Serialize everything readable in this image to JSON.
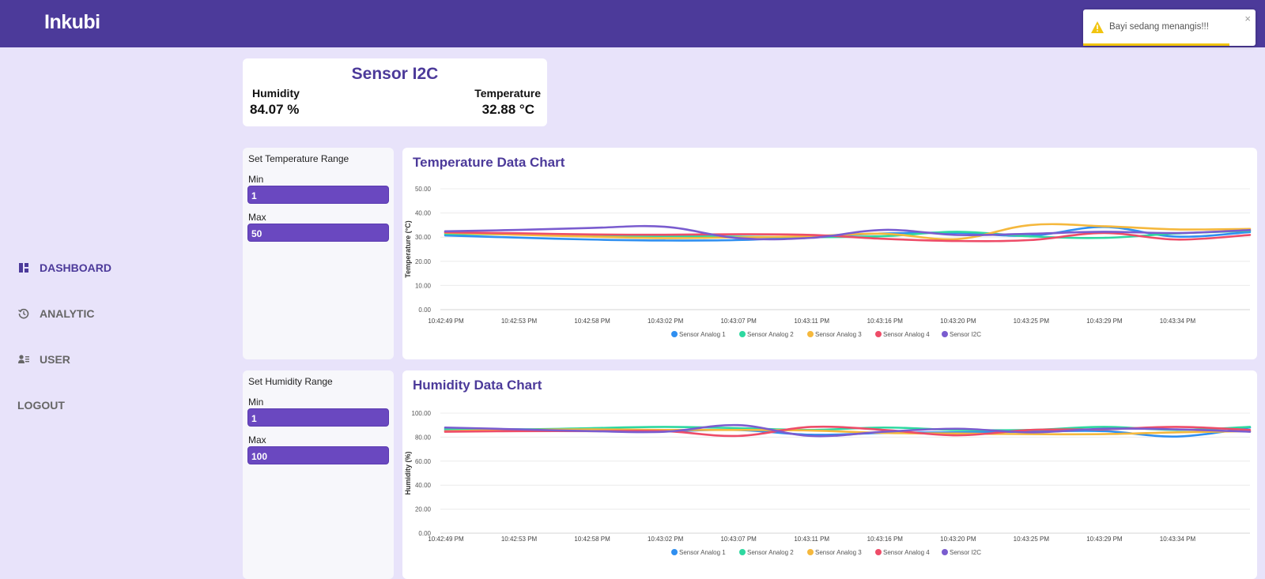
{
  "app": {
    "brand": "Inkubi"
  },
  "toast": {
    "message": "Bayi sedang menangis!!!",
    "close": "×",
    "icon": "warning-icon",
    "progress": 0.85
  },
  "nav": {
    "items": [
      {
        "label": "DASHBOARD",
        "icon": "dashboard-icon",
        "active": true
      },
      {
        "label": "ANALYTIC",
        "icon": "history-icon",
        "active": false
      },
      {
        "label": "USER",
        "icon": "user-list-icon",
        "active": false
      },
      {
        "label": "LOGOUT",
        "icon": "",
        "active": false
      }
    ]
  },
  "sensor_i2c": {
    "title": "Sensor I2C",
    "humidity_label": "Humidity",
    "humidity_value": "84.07 %",
    "temperature_label": "Temperature",
    "temperature_value": "32.88 °C"
  },
  "temp_range": {
    "title": "Set Temperature Range",
    "min_label": "Min",
    "min_value": "1",
    "max_label": "Max",
    "max_value": "50"
  },
  "hum_range": {
    "title": "Set Humidity Range",
    "min_label": "Min",
    "min_value": "1",
    "max_label": "Max",
    "max_value": "100"
  },
  "colors": {
    "accent": "#4c3a9a",
    "series": [
      "#2f8ff0",
      "#2ed8a0",
      "#f5b83d",
      "#ee4c68",
      "#7a5ccf"
    ]
  },
  "chart_data": [
    {
      "type": "line",
      "title": "Temperature Data Chart",
      "ylabel": "Temperature (°C)",
      "ylim": [
        0,
        50
      ],
      "yticks": [
        "0.00",
        "10.00",
        "20.00",
        "30.00",
        "40.00",
        "50.00"
      ],
      "x": [
        "10:42:49 PM",
        "10:42:53 PM",
        "10:42:58 PM",
        "10:43:02 PM",
        "10:43:07 PM",
        "10:43:11 PM",
        "10:43:16 PM",
        "10:43:20 PM",
        "10:43:25 PM",
        "10:43:29 PM",
        "10:43:34 PM",
        ""
      ],
      "grid": true,
      "legend": "bottom",
      "series": [
        {
          "name": "Sensor Analog 1",
          "values": [
            30.7,
            29.8,
            29.0,
            28.6,
            28.8,
            30.1,
            31.5,
            31.8,
            30.6,
            34.2,
            30.2,
            32.1
          ]
        },
        {
          "name": "Sensor Analog 2",
          "values": [
            31.3,
            31.1,
            30.6,
            30.5,
            30.2,
            30.0,
            30.4,
            32.2,
            30.3,
            29.7,
            31.5,
            32.6
          ]
        },
        {
          "name": "Sensor Analog 3",
          "values": [
            31.8,
            31.0,
            30.2,
            29.6,
            29.9,
            30.4,
            31.4,
            29.2,
            35.0,
            34.5,
            33.2,
            33.4
          ]
        },
        {
          "name": "Sensor Analog 4",
          "values": [
            32.0,
            31.6,
            31.1,
            31.0,
            31.2,
            30.9,
            29.3,
            28.4,
            28.8,
            31.7,
            29.0,
            30.9
          ]
        },
        {
          "name": "Sensor I2C",
          "values": [
            32.4,
            33.0,
            33.8,
            34.3,
            29.6,
            29.7,
            33.0,
            30.9,
            31.4,
            32.2,
            31.7,
            32.9
          ]
        }
      ]
    },
    {
      "type": "line",
      "title": "Humidity Data Chart",
      "ylabel": "Humidity (%)",
      "ylim": [
        0,
        100
      ],
      "yticks": [
        "0.00",
        "20.00",
        "40.00",
        "60.00",
        "80.00",
        "100.00"
      ],
      "x": [
        "10:42:49 PM",
        "10:42:53 PM",
        "10:42:58 PM",
        "10:43:02 PM",
        "10:43:07 PM",
        "10:43:11 PM",
        "10:43:16 PM",
        "10:43:20 PM",
        "10:43:25 PM",
        "10:43:29 PM",
        "10:43:34 PM",
        ""
      ],
      "grid": true,
      "legend": "bottom",
      "series": [
        {
          "name": "Sensor Analog 1",
          "values": [
            86,
            86.5,
            85.5,
            85,
            86,
            82,
            83.5,
            84,
            84.5,
            85,
            80.5,
            88
          ]
        },
        {
          "name": "Sensor Analog 2",
          "values": [
            87,
            86.5,
            87.5,
            88.5,
            87.5,
            86,
            88,
            86,
            86,
            88.5,
            86,
            88.5
          ]
        },
        {
          "name": "Sensor Analog 3",
          "values": [
            85,
            86,
            86.5,
            86,
            86,
            85.5,
            83.5,
            83,
            82.5,
            82.5,
            84,
            85
          ]
        },
        {
          "name": "Sensor Analog 4",
          "values": [
            84.5,
            85,
            85,
            85,
            81,
            88.5,
            86,
            81.5,
            86,
            86.5,
            88.5,
            86
          ]
        },
        {
          "name": "Sensor I2C",
          "values": [
            88,
            86.5,
            85,
            84.5,
            90,
            81,
            84.5,
            87,
            84,
            87,
            86.5,
            84.5
          ]
        }
      ]
    }
  ]
}
